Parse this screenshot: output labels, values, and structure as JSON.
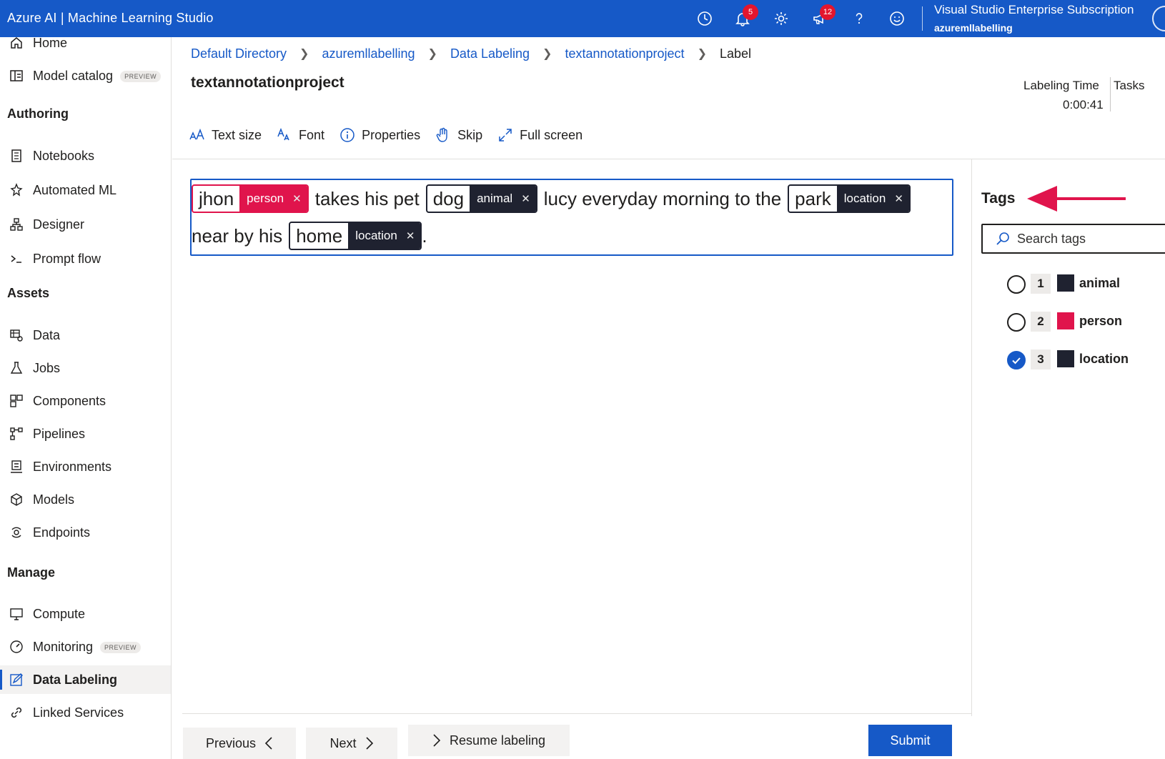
{
  "header": {
    "app_title": "Azure AI | Machine Learning Studio",
    "notifications_count": "5",
    "feedback_count": "12",
    "subscription": "Visual Studio Enterprise Subscription",
    "account": "azuremllabelling"
  },
  "sidebar": {
    "top_items": [
      {
        "label": "Home",
        "icon": "home-icon"
      },
      {
        "label": "Model catalog",
        "icon": "catalog-icon",
        "badge": "PREVIEW"
      }
    ],
    "sections": [
      {
        "title": "Authoring",
        "items": [
          {
            "label": "Notebooks",
            "icon": "notebook-icon"
          },
          {
            "label": "Automated ML",
            "icon": "automated-ml-icon"
          },
          {
            "label": "Designer",
            "icon": "designer-icon"
          },
          {
            "label": "Prompt flow",
            "icon": "prompt-flow-icon"
          }
        ]
      },
      {
        "title": "Assets",
        "items": [
          {
            "label": "Data",
            "icon": "data-icon"
          },
          {
            "label": "Jobs",
            "icon": "jobs-icon"
          },
          {
            "label": "Components",
            "icon": "components-icon"
          },
          {
            "label": "Pipelines",
            "icon": "pipelines-icon"
          },
          {
            "label": "Environments",
            "icon": "environments-icon"
          },
          {
            "label": "Models",
            "icon": "models-icon"
          },
          {
            "label": "Endpoints",
            "icon": "endpoints-icon"
          }
        ]
      },
      {
        "title": "Manage",
        "items": [
          {
            "label": "Compute",
            "icon": "compute-icon"
          },
          {
            "label": "Monitoring",
            "icon": "monitoring-icon",
            "badge": "PREVIEW"
          },
          {
            "label": "Data Labeling",
            "icon": "data-labeling-icon",
            "active": true
          },
          {
            "label": "Linked Services",
            "icon": "linked-services-icon"
          }
        ]
      }
    ]
  },
  "breadcrumb": [
    "Default Directory",
    "azuremllabelling",
    "Data Labeling",
    "textannotationproject",
    "Label"
  ],
  "page": {
    "title": "textannotationproject",
    "labeling_time_label": "Labeling Time",
    "labeling_time_value": "0:00:41",
    "tasks_label": "Tasks"
  },
  "toolbar": {
    "text_size": "Text size",
    "font": "Font",
    "properties": "Properties",
    "skip": "Skip",
    "full_screen": "Full screen"
  },
  "annotation": {
    "line1": {
      "e1_word": "jhon",
      "e1_tag": "person",
      "t1": "takes his pet",
      "e2_word": "dog",
      "e2_tag": "animal",
      "t2": "lucy everyday morning to the",
      "e3_word": "park",
      "e3_tag": "location"
    },
    "line2": {
      "t1": "near by his",
      "e1_word": "home",
      "e1_tag": "location",
      "t2": "."
    }
  },
  "tags_panel": {
    "title": "Tags",
    "search_placeholder": "Search tags",
    "tags": [
      {
        "key": "1",
        "name": "animal",
        "color": "#1f2230",
        "selected": false
      },
      {
        "key": "2",
        "name": "person",
        "color": "#e0144c",
        "selected": false
      },
      {
        "key": "3",
        "name": "location",
        "color": "#1f2230",
        "selected": true
      }
    ]
  },
  "footer": {
    "previous": "Previous",
    "next": "Next",
    "resume": "Resume labeling",
    "submit": "Submit"
  },
  "colors": {
    "accent": "#1659c7",
    "person": "#e0144c",
    "entity_dark": "#1f2230",
    "annotation_arrow": "#e0144c"
  }
}
